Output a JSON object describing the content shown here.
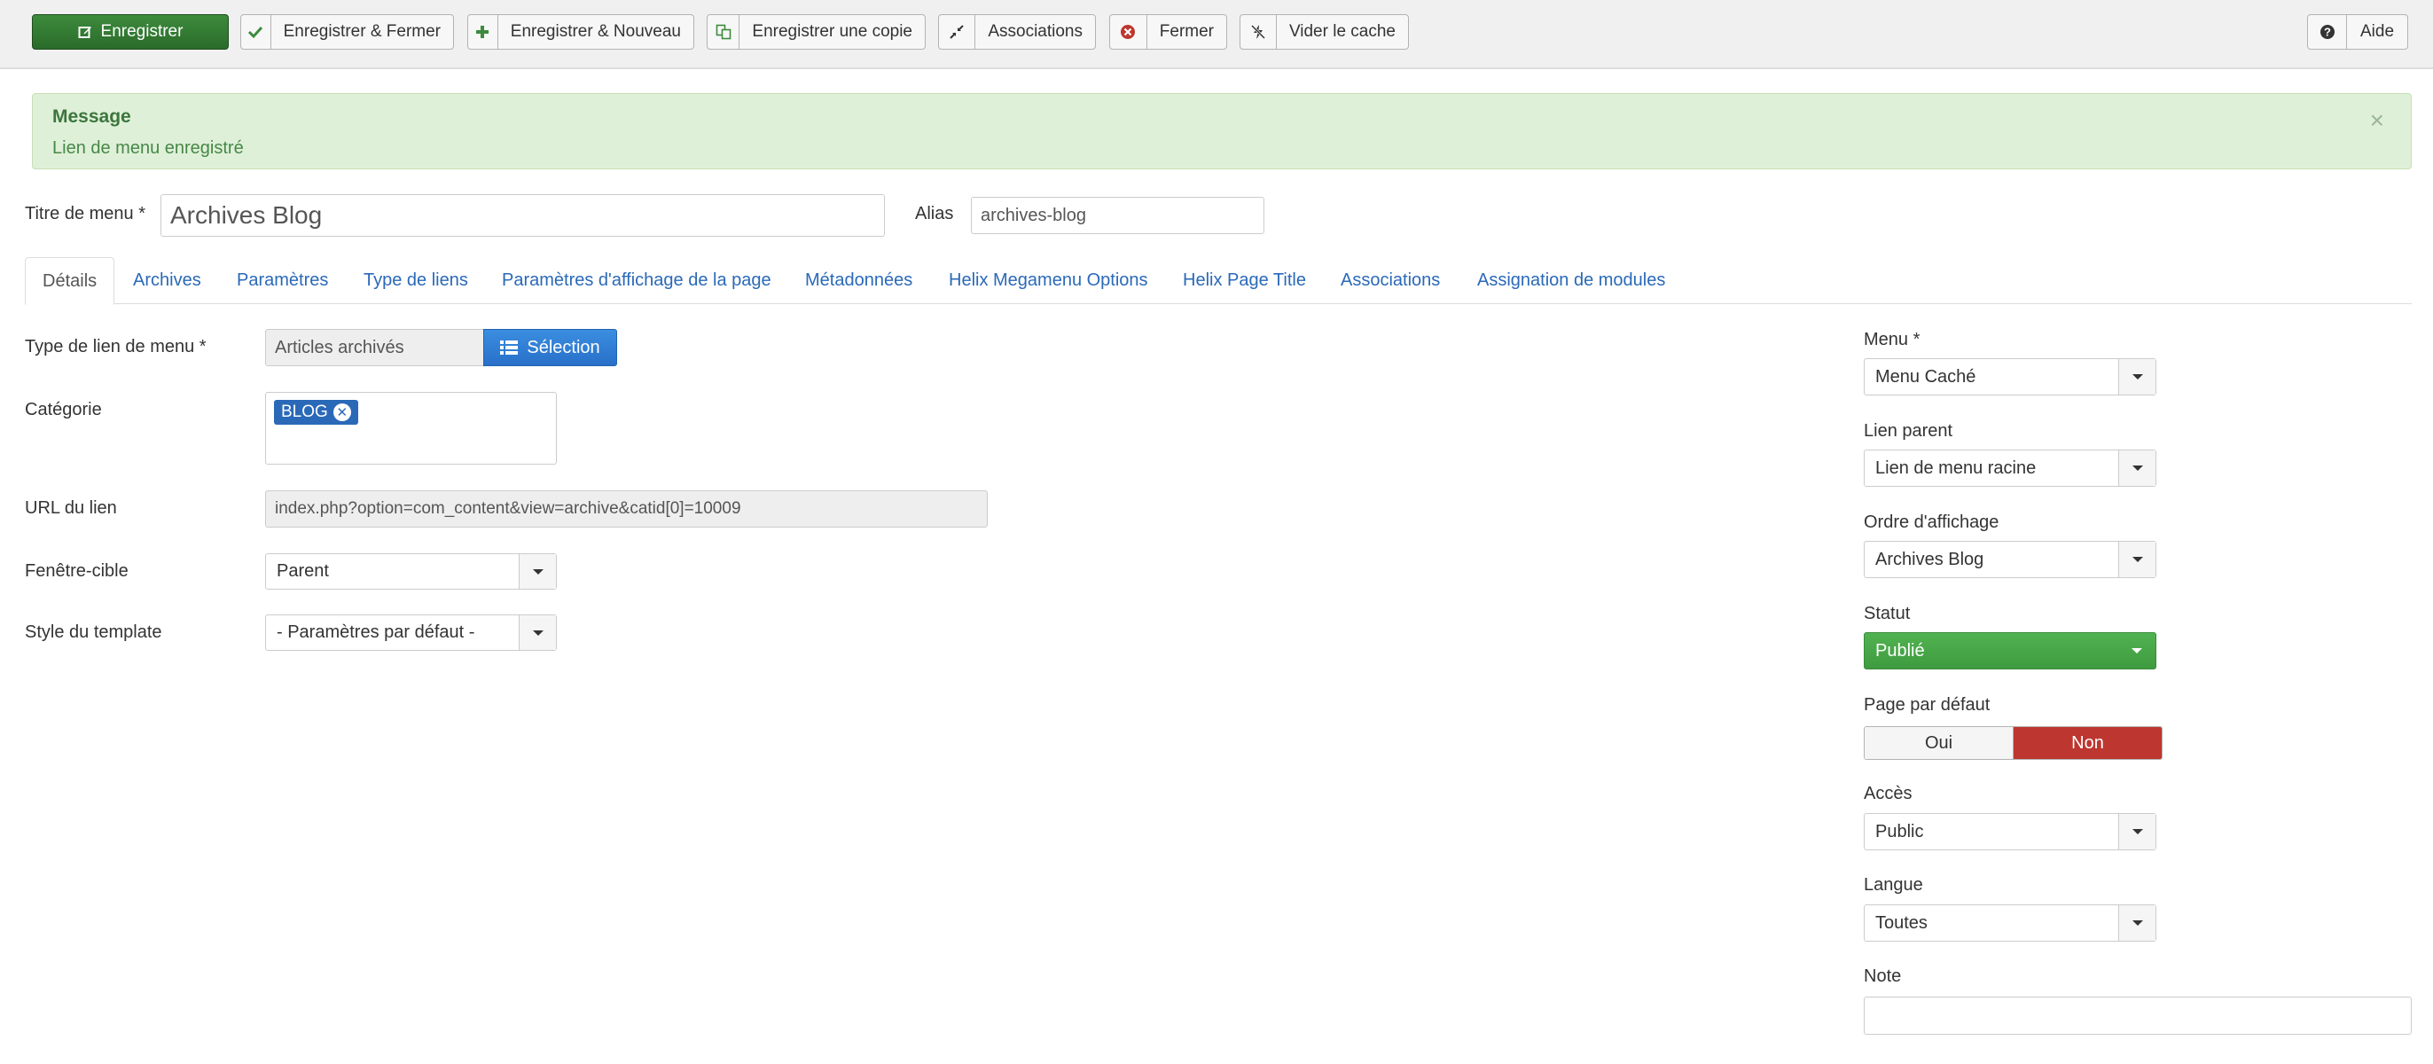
{
  "toolbar": {
    "save": "Enregistrer",
    "save_close": "Enregistrer & Fermer",
    "save_new": "Enregistrer & Nouveau",
    "save_copy": "Enregistrer une copie",
    "associations": "Associations",
    "close": "Fermer",
    "clear_cache": "Vider le cache",
    "help": "Aide"
  },
  "message": {
    "title": "Message",
    "text": "Lien de menu enregistré",
    "close_glyph": "×"
  },
  "form": {
    "title_label": "Titre de menu *",
    "title_value": "Archives Blog",
    "alias_label": "Alias",
    "alias_value": "archives-blog"
  },
  "tabs": [
    {
      "label": "Détails",
      "active": true
    },
    {
      "label": "Archives"
    },
    {
      "label": "Paramètres"
    },
    {
      "label": "Type de liens"
    },
    {
      "label": "Paramètres d'affichage de la page"
    },
    {
      "label": "Métadonnées"
    },
    {
      "label": "Helix Megamenu Options"
    },
    {
      "label": "Helix Page Title"
    },
    {
      "label": "Associations"
    },
    {
      "label": "Assignation de modules"
    }
  ],
  "details": {
    "type_label": "Type de lien de menu *",
    "type_value": "Articles archivés",
    "select_button": "Sélection",
    "category_label": "Catégorie",
    "category_chip": "BLOG",
    "url_label": "URL du lien",
    "url_value": "index.php?option=com_content&view=archive&catid[0]=10009",
    "target_label": "Fenêtre-cible",
    "target_value": "Parent",
    "template_label": "Style du template",
    "template_value": "- Paramètres par défaut -"
  },
  "sidebar": {
    "menu_label": "Menu *",
    "menu_value": "Menu Caché",
    "parent_label": "Lien parent",
    "parent_value": "Lien de menu racine",
    "order_label": "Ordre d'affichage",
    "order_value": "Archives Blog",
    "status_label": "Statut",
    "status_value": "Publié",
    "default_label": "Page par défaut",
    "default_yes": "Oui",
    "default_no": "Non",
    "access_label": "Accès",
    "access_value": "Public",
    "language_label": "Langue",
    "language_value": "Toutes",
    "note_label": "Note",
    "note_value": ""
  },
  "colors": {
    "primary_green": "#2f7d32",
    "link_blue": "#2a69b8",
    "select_blue": "#2f7ed8",
    "status_green": "#46a546",
    "no_red": "#bd362f",
    "alert_bg": "#dff0d8"
  },
  "icons": {
    "save": "edit-icon",
    "save_close": "check-icon",
    "save_new": "plus-icon",
    "save_copy": "copy-icon",
    "associations": "contract-icon",
    "close": "cancel-circle-icon",
    "clear_cache": "no-lightning-icon",
    "help": "question-circle-icon",
    "select": "list-icon",
    "remove_chip": "remove-circle-icon"
  }
}
